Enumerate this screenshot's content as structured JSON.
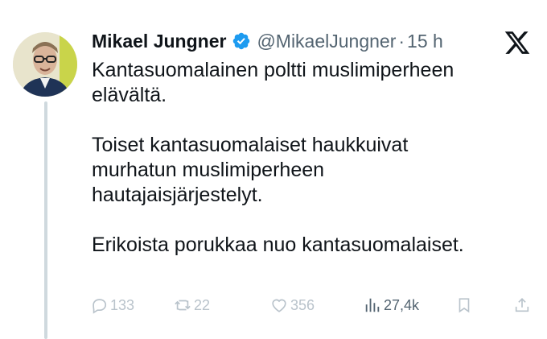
{
  "author": {
    "name": "Mikael Jungner",
    "handle": "@MikaelJungner",
    "separator": "·",
    "time": "15 h"
  },
  "tweet": {
    "paragraphs": [
      "Kantasuomalainen poltti muslimiperheen\nelävältä.",
      "Toiset kantasuomalaiset haukkuivat\nmurhatun muslimiperheen\nhautajaisjärjestelyt.",
      "Erikoista porukkaa nuo kantasuomalaiset."
    ]
  },
  "actions": {
    "replies": "133",
    "retweets": "22",
    "likes": "356",
    "views": "27,4k"
  },
  "colors": {
    "verified": "#1d9bf0",
    "text": "#0f1419",
    "secondary": "#536471",
    "faded_action": "#b9c3cb",
    "thread_line": "#cfd9de"
  },
  "icons": [
    "verified-badge-icon",
    "x-logo-icon",
    "reply-icon",
    "retweet-icon",
    "like-icon",
    "views-icon",
    "bookmark-icon",
    "share-icon"
  ]
}
